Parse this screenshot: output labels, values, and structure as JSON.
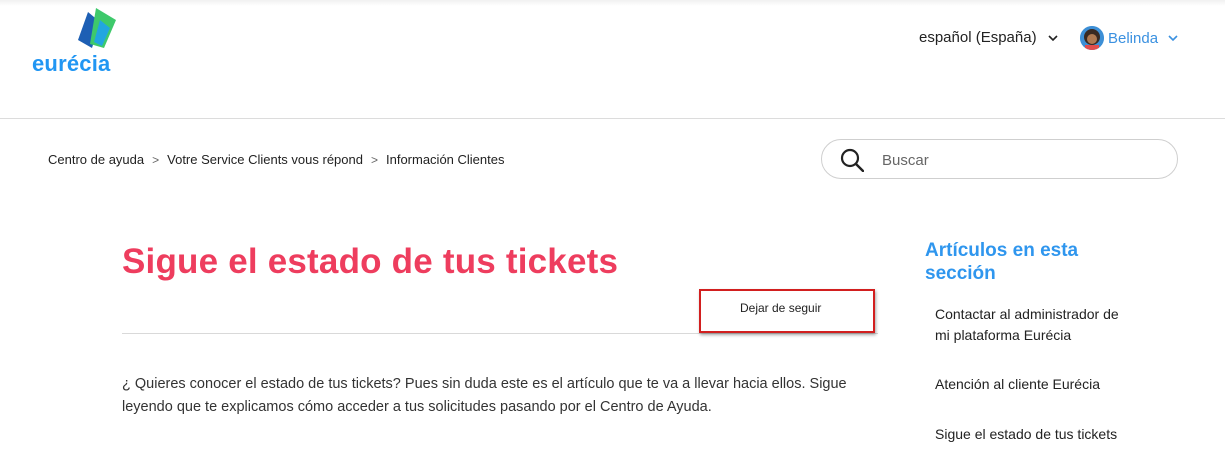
{
  "header": {
    "logo_text": "eurécia",
    "language": "español (España)",
    "user_name": "Belinda"
  },
  "breadcrumb": {
    "items": [
      "Centro de ayuda",
      "Votre Service Clients vous répond",
      "Información Clientes"
    ],
    "separator": ">"
  },
  "search": {
    "placeholder": "Buscar"
  },
  "article": {
    "title": "Sigue el estado de tus tickets",
    "follow_label": "Dejar de seguir",
    "body_line1": "¿ Quieres conocer el estado de tus tickets? Pues sin duda este es el artículo que te va a llevar hacia ellos. Sigue",
    "body_line2": "leyendo que te explicamos cómo acceder a tus solicitudes pasando por el Centro de Ayuda."
  },
  "sidebar": {
    "title": "Artículos en esta sección",
    "links": [
      "Contactar al administrador de mi plataforma Eurécia",
      "Atención al cliente Eurécia",
      "Sigue el estado de tus tickets"
    ]
  },
  "colors": {
    "title": "#ee3d5e",
    "accent_blue": "#2f96ee",
    "highlight": "#d21f1f",
    "logo_green": "#3ec96b"
  },
  "icons": {
    "search": "search-icon",
    "chevron": "chevron-down-icon",
    "avatar": "avatar"
  }
}
